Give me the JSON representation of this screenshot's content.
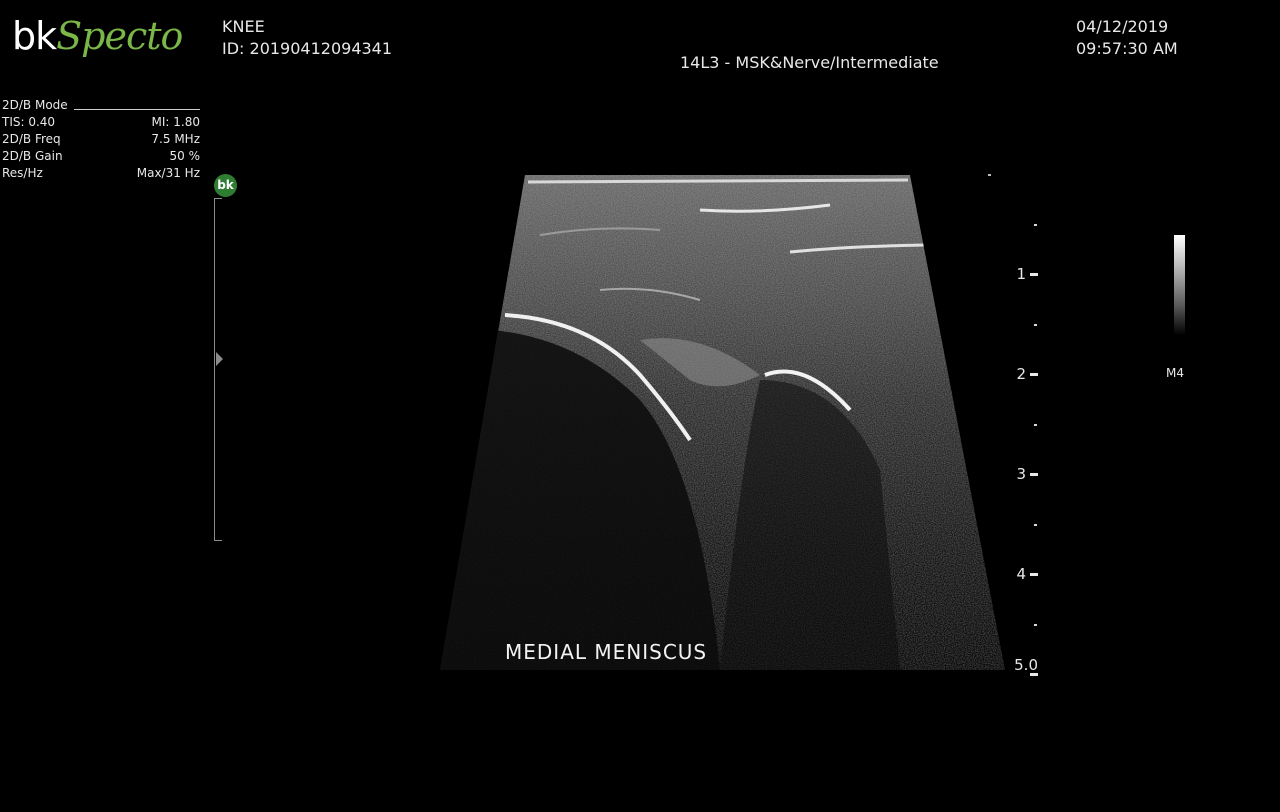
{
  "header": {
    "logo_part1": "bk",
    "logo_part2": "Specto",
    "exam": "KNEE",
    "patient_id": "ID: 20190412094341",
    "probe_preset": "14L3 - MSK&Nerve/Intermediate",
    "date": "04/12/2019",
    "time": "09:57:30 AM"
  },
  "params": {
    "mode": "2D/B Mode",
    "tis": "TIS: 0.40",
    "mi": "MI: 1.80",
    "freq_label": "2D/B Freq",
    "freq_value": "7.5 MHz",
    "gain_label": "2D/B Gain",
    "gain_value": "50 %",
    "res_label": "Res/Hz",
    "res_value": "Max/31 Hz"
  },
  "badge": "bk",
  "depth_scale": {
    "labels": [
      "1",
      "2",
      "3",
      "4",
      "5.0"
    ]
  },
  "gray_map": "M4",
  "annotation": "MEDIAL MENISCUS",
  "colors": {
    "background": "#000000",
    "logo_green": "#7ab648",
    "badge_green": "#2f7d32",
    "text": "#e8e8e8"
  }
}
